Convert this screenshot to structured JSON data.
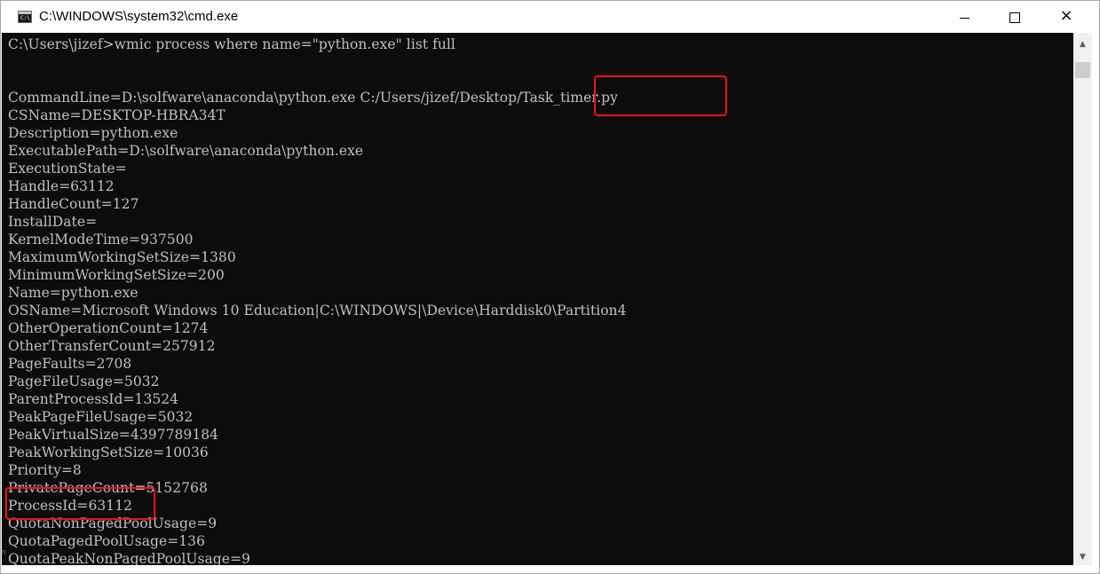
{
  "window": {
    "title": "C:\\WINDOWS\\system32\\cmd.exe",
    "app_icon_text": "C:\\",
    "controls": {
      "minimize": "minimize",
      "maximize": "maximize",
      "close": "×"
    }
  },
  "console": {
    "lines": [
      "C:\\Users\\jizef>wmic process where name=\"python.exe\" list full",
      "",
      "",
      "CommandLine=D:\\solfware\\anaconda\\python.exe C:/Users/jizef/Desktop/Task_timer.py",
      "CSName=DESKTOP-HBRA34T",
      "Description=python.exe",
      "ExecutablePath=D:\\solfware\\anaconda\\python.exe",
      "ExecutionState=",
      "Handle=63112",
      "HandleCount=127",
      "InstallDate=",
      "KernelModeTime=937500",
      "MaximumWorkingSetSize=1380",
      "MinimumWorkingSetSize=200",
      "Name=python.exe",
      "OSName=Microsoft Windows 10 Education|C:\\WINDOWS|\\Device\\Harddisk0\\Partition4",
      "OtherOperationCount=1274",
      "OtherTransferCount=257912",
      "PageFaults=2708",
      "PageFileUsage=5032",
      "ParentProcessId=13524",
      "PeakPageFileUsage=5032",
      "PeakVirtualSize=4397789184",
      "PeakWorkingSetSize=10036",
      "Priority=8",
      "PrivatePageCount=5152768",
      "ProcessId=63112",
      "QuotaNonPagedPoolUsage=9",
      "QuotaPagedPoolUsage=136",
      "QuotaPeakNonPagedPoolUsage=9"
    ]
  },
  "scrollbar": {
    "up_arrow": "▲",
    "down_arrow": "▼"
  },
  "edge_mark": "n",
  "colors": {
    "console_bg": "#0c0c0c",
    "console_text": "#c0c0c0",
    "highlight": "#e8141c",
    "scrollbar_bg": "#f0f0f0",
    "scroll_thumb": "#cdcdcd"
  }
}
